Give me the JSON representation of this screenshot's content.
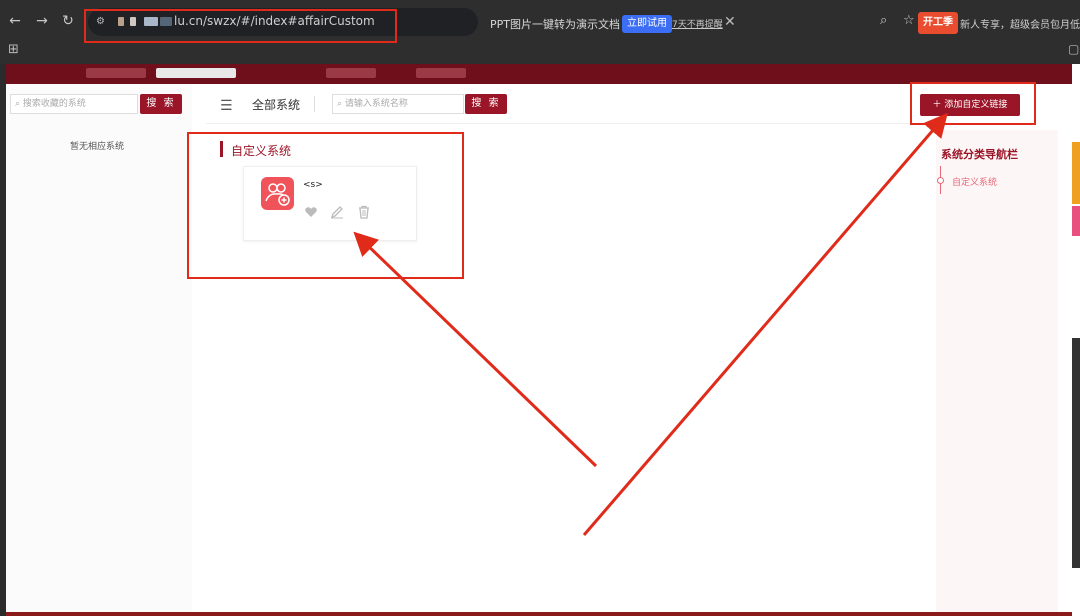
{
  "browser": {
    "url_visible": "lu.cn/swzx/#/index#affairCustom",
    "banner_text": "PPT图片一键转为演示文档",
    "banner_button": "立即试用",
    "banner_link": "7天不再提醒",
    "promo_badge": "开工季",
    "promo_text": "新人专享，超级会员包月低至"
  },
  "left_panel": {
    "search_placeholder": "搜索收藏的系统",
    "search_button": "搜 索",
    "empty_text": "暂无相应系统"
  },
  "toolbar": {
    "all_systems": "全部系统",
    "search_placeholder": "请输入系统名称",
    "search_button": "搜 索",
    "add_link_button": "添加自定义链接"
  },
  "section": {
    "title": "自定义系统",
    "card_name": "<s>"
  },
  "right_nav": {
    "title": "系统分类导航栏",
    "item": "自定义系统"
  },
  "colors": {
    "brand": "#9b1528",
    "annotation": "#e02a1a",
    "card_icon": "#f0545a"
  }
}
